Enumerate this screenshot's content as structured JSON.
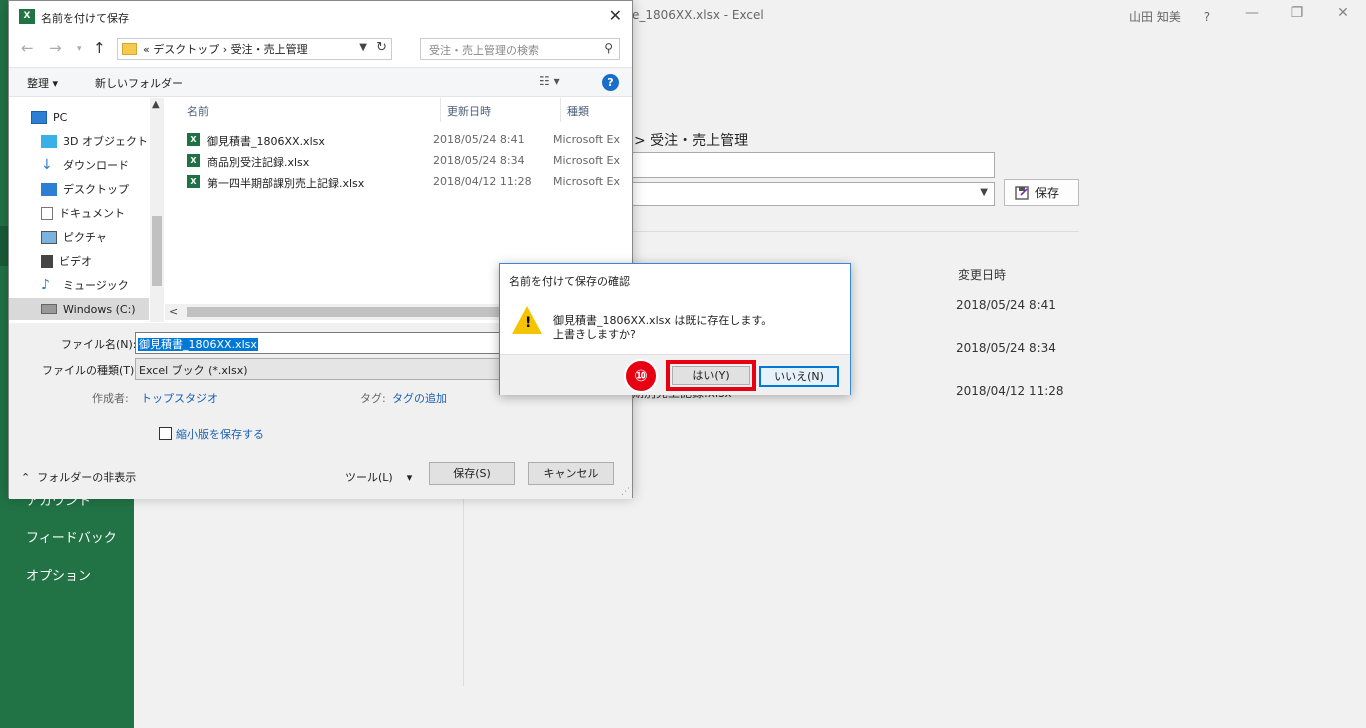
{
  "excel": {
    "window_title": "名前を付けて保存 - 御見積書_1806XX.xlsx  -  Excel",
    "title_suffix": "e_1806XX.xlsx  -  Excel",
    "user": "山田 知美",
    "help": "?",
    "breadcrumb": "> 受注・売上管理",
    "save_label": "保存",
    "col_modified": "変更日時",
    "dates": [
      "2018/05/24 8:41",
      "2018/05/24 8:34",
      "2018/04/12 11:28"
    ],
    "partial_name": "期別売上記録.xlsx",
    "sidebar": [
      "アカウント",
      "フィードバック",
      "オプション"
    ]
  },
  "save_dialog": {
    "title": "名前を付けて保存",
    "address_path": "«  デスクトップ  ›  受注・売上管理",
    "search_placeholder": "受注・売上管理の検索",
    "organize": "整理 ▾",
    "new_folder": "新しいフォルダー",
    "nav_items": [
      "PC",
      "3D オブジェクト",
      "ダウンロード",
      "デスクトップ",
      "ドキュメント",
      "ピクチャ",
      "ビデオ",
      "ミュージック",
      "Windows (C:)"
    ],
    "columns": {
      "name": "名前",
      "date": "更新日時",
      "type": "種類"
    },
    "files": [
      {
        "name": "御見積書_1806XX.xlsx",
        "date": "2018/05/24 8:41",
        "type": "Microsoft Ex"
      },
      {
        "name": "商品別受注記録.xlsx",
        "date": "2018/05/24 8:34",
        "type": "Microsoft Ex"
      },
      {
        "name": "第一四半期部課別売上記録.xlsx",
        "date": "2018/04/12 11:28",
        "type": "Microsoft Ex"
      }
    ],
    "filename_label": "ファイル名(N):",
    "filename_value": "御見積書_1806XX.xlsx",
    "filetype_label": "ファイルの種類(T):",
    "filetype_value": "Excel ブック (*.xlsx)",
    "author_label": "作成者:",
    "author_value": "トップスタジオ",
    "tag_label": "タグ:",
    "tag_value": "タグの追加",
    "thumbnail_label": "縮小版を保存する",
    "hide_folders": "フォルダーの非表示",
    "tools": "ツール(L)",
    "save": "保存(S)",
    "cancel": "キャンセル"
  },
  "confirm_dialog": {
    "title": "名前を付けて保存の確認",
    "message_line1": "御見積書_1806XX.xlsx は既に存在します。",
    "message_line2": "上書きしますか?",
    "yes": "はい(Y)",
    "no": "いいえ(N)",
    "step_badge": "⑩"
  },
  "colors": {
    "excel_green": "#217346",
    "highlight_red": "#e60012",
    "accent_blue": "#0078d7"
  }
}
